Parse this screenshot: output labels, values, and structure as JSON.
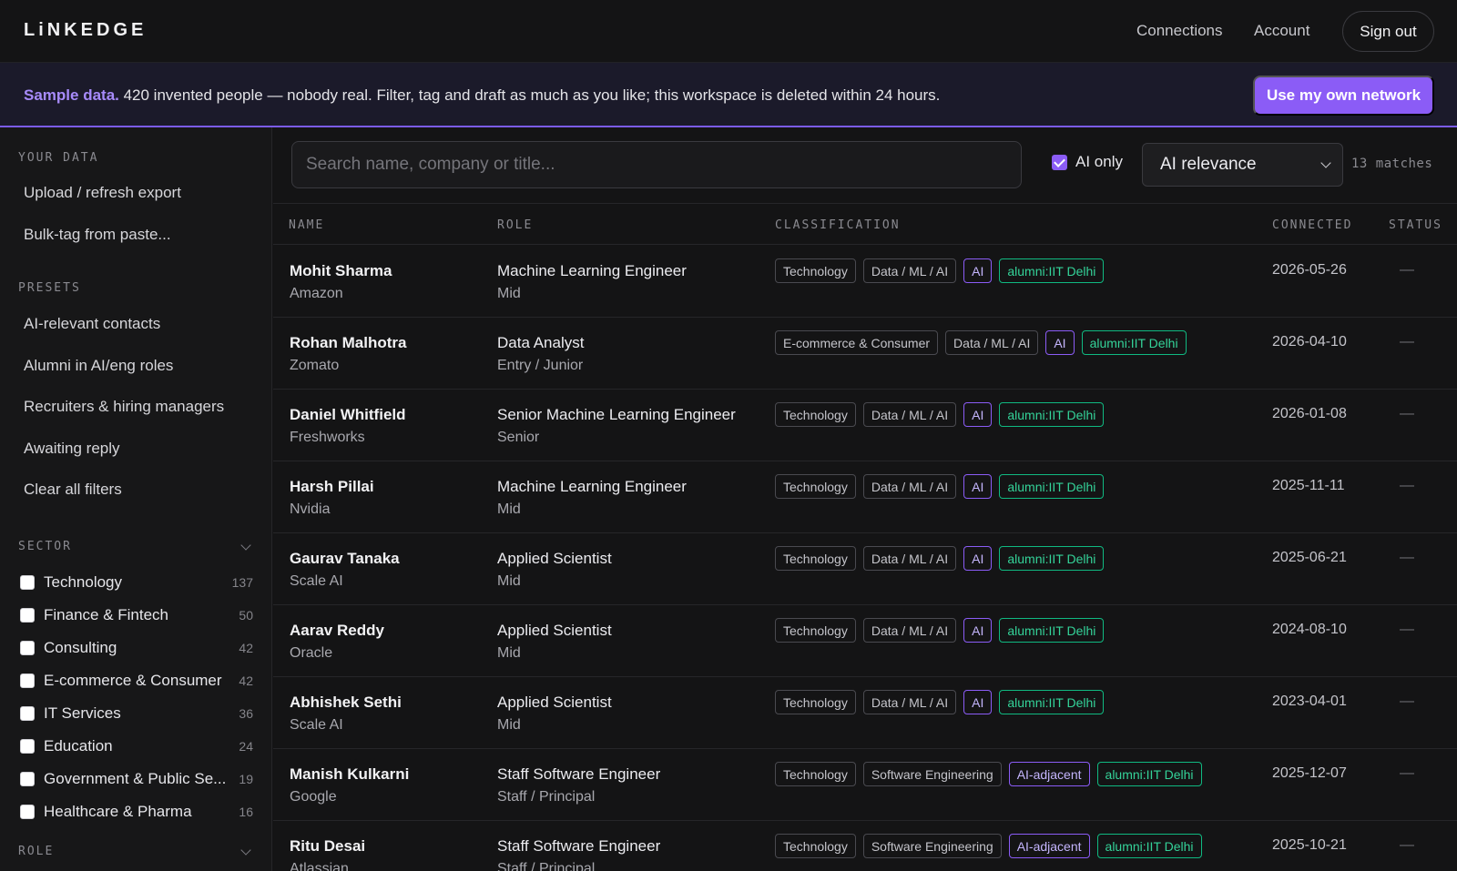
{
  "app": {
    "logo": "LiNKEDGE",
    "nav": {
      "connections": "Connections",
      "account": "Account",
      "sign_out": "Sign out"
    }
  },
  "banner": {
    "strong": "Sample data.",
    "text": " 420 invented people — nobody real. Filter, tag and draft as much as you like; this workspace is deleted within 24 hours.",
    "button": "Use my own network"
  },
  "sidebar": {
    "your_data": {
      "heading": "YOUR DATA",
      "items": [
        "Upload / refresh export",
        "Bulk-tag from paste..."
      ]
    },
    "presets": {
      "heading": "PRESETS",
      "items": [
        "AI-relevant contacts",
        "Alumni in AI/eng roles",
        "Recruiters & hiring managers",
        "Awaiting reply",
        "Clear all filters"
      ]
    },
    "sector": {
      "heading": "SECTOR",
      "items": [
        {
          "label": "Technology",
          "count": "137"
        },
        {
          "label": "Finance & Fintech",
          "count": "50"
        },
        {
          "label": "Consulting",
          "count": "42"
        },
        {
          "label": "E-commerce & Consumer",
          "count": "42"
        },
        {
          "label": "IT Services",
          "count": "36"
        },
        {
          "label": "Education",
          "count": "24"
        },
        {
          "label": "Government & Public Se...",
          "count": "19"
        },
        {
          "label": "Healthcare & Pharma",
          "count": "16"
        }
      ]
    },
    "role": {
      "heading": "ROLE"
    }
  },
  "toolbar": {
    "search_placeholder": "Search name, company or title...",
    "ai_only_label": "AI only",
    "ai_only_checked": true,
    "sort_value": "AI relevance",
    "matches": "13 matches"
  },
  "table": {
    "headers": {
      "name": "NAME",
      "role": "ROLE",
      "classification": "CLASSIFICATION",
      "connected": "CONNECTED",
      "status": "STATUS"
    },
    "rows": [
      {
        "name": "Mohit Sharma",
        "company": "Amazon",
        "title": "Machine Learning Engineer",
        "seniority": "Mid",
        "tags": [
          {
            "text": "Technology",
            "kind": "sector"
          },
          {
            "text": "Data / ML / AI",
            "kind": "function"
          },
          {
            "text": "AI",
            "kind": "ai"
          },
          {
            "text": "alumni:IIT Delhi",
            "kind": "alumni"
          }
        ],
        "connected": "2026-05-26",
        "status": "—"
      },
      {
        "name": "Rohan Malhotra",
        "company": "Zomato",
        "title": "Data Analyst",
        "seniority": "Entry / Junior",
        "tags": [
          {
            "text": "E-commerce & Consumer",
            "kind": "sector"
          },
          {
            "text": "Data / ML / AI",
            "kind": "function"
          },
          {
            "text": "AI",
            "kind": "ai"
          },
          {
            "text": "alumni:IIT Delhi",
            "kind": "alumni"
          }
        ],
        "connected": "2026-04-10",
        "status": "—"
      },
      {
        "name": "Daniel Whitfield",
        "company": "Freshworks",
        "title": "Senior Machine Learning Engineer",
        "seniority": "Senior",
        "tags": [
          {
            "text": "Technology",
            "kind": "sector"
          },
          {
            "text": "Data / ML / AI",
            "kind": "function"
          },
          {
            "text": "AI",
            "kind": "ai"
          },
          {
            "text": "alumni:IIT Delhi",
            "kind": "alumni"
          }
        ],
        "connected": "2026-01-08",
        "status": "—"
      },
      {
        "name": "Harsh Pillai",
        "company": "Nvidia",
        "title": "Machine Learning Engineer",
        "seniority": "Mid",
        "tags": [
          {
            "text": "Technology",
            "kind": "sector"
          },
          {
            "text": "Data / ML / AI",
            "kind": "function"
          },
          {
            "text": "AI",
            "kind": "ai"
          },
          {
            "text": "alumni:IIT Delhi",
            "kind": "alumni"
          }
        ],
        "connected": "2025-11-11",
        "status": "—"
      },
      {
        "name": "Gaurav Tanaka",
        "company": "Scale AI",
        "title": "Applied Scientist",
        "seniority": "Mid",
        "tags": [
          {
            "text": "Technology",
            "kind": "sector"
          },
          {
            "text": "Data / ML / AI",
            "kind": "function"
          },
          {
            "text": "AI",
            "kind": "ai"
          },
          {
            "text": "alumni:IIT Delhi",
            "kind": "alumni"
          }
        ],
        "connected": "2025-06-21",
        "status": "—"
      },
      {
        "name": "Aarav Reddy",
        "company": "Oracle",
        "title": "Applied Scientist",
        "seniority": "Mid",
        "tags": [
          {
            "text": "Technology",
            "kind": "sector"
          },
          {
            "text": "Data / ML / AI",
            "kind": "function"
          },
          {
            "text": "AI",
            "kind": "ai"
          },
          {
            "text": "alumni:IIT Delhi",
            "kind": "alumni"
          }
        ],
        "connected": "2024-08-10",
        "status": "—"
      },
      {
        "name": "Abhishek Sethi",
        "company": "Scale AI",
        "title": "Applied Scientist",
        "seniority": "Mid",
        "tags": [
          {
            "text": "Technology",
            "kind": "sector"
          },
          {
            "text": "Data / ML / AI",
            "kind": "function"
          },
          {
            "text": "AI",
            "kind": "ai"
          },
          {
            "text": "alumni:IIT Delhi",
            "kind": "alumni"
          }
        ],
        "connected": "2023-04-01",
        "status": "—"
      },
      {
        "name": "Manish Kulkarni",
        "company": "Google",
        "title": "Staff Software Engineer",
        "seniority": "Staff / Principal",
        "tags": [
          {
            "text": "Technology",
            "kind": "sector"
          },
          {
            "text": "Software Engineering",
            "kind": "function"
          },
          {
            "text": "AI-adjacent",
            "kind": "ai"
          },
          {
            "text": "alumni:IIT Delhi",
            "kind": "alumni"
          }
        ],
        "connected": "2025-12-07",
        "status": "—"
      },
      {
        "name": "Ritu Desai",
        "company": "Atlassian",
        "title": "Staff Software Engineer",
        "seniority": "Staff / Principal",
        "tags": [
          {
            "text": "Technology",
            "kind": "sector"
          },
          {
            "text": "Software Engineering",
            "kind": "function"
          },
          {
            "text": "AI-adjacent",
            "kind": "ai"
          },
          {
            "text": "alumni:IIT Delhi",
            "kind": "alumni"
          }
        ],
        "connected": "2025-10-21",
        "status": "—"
      }
    ]
  }
}
